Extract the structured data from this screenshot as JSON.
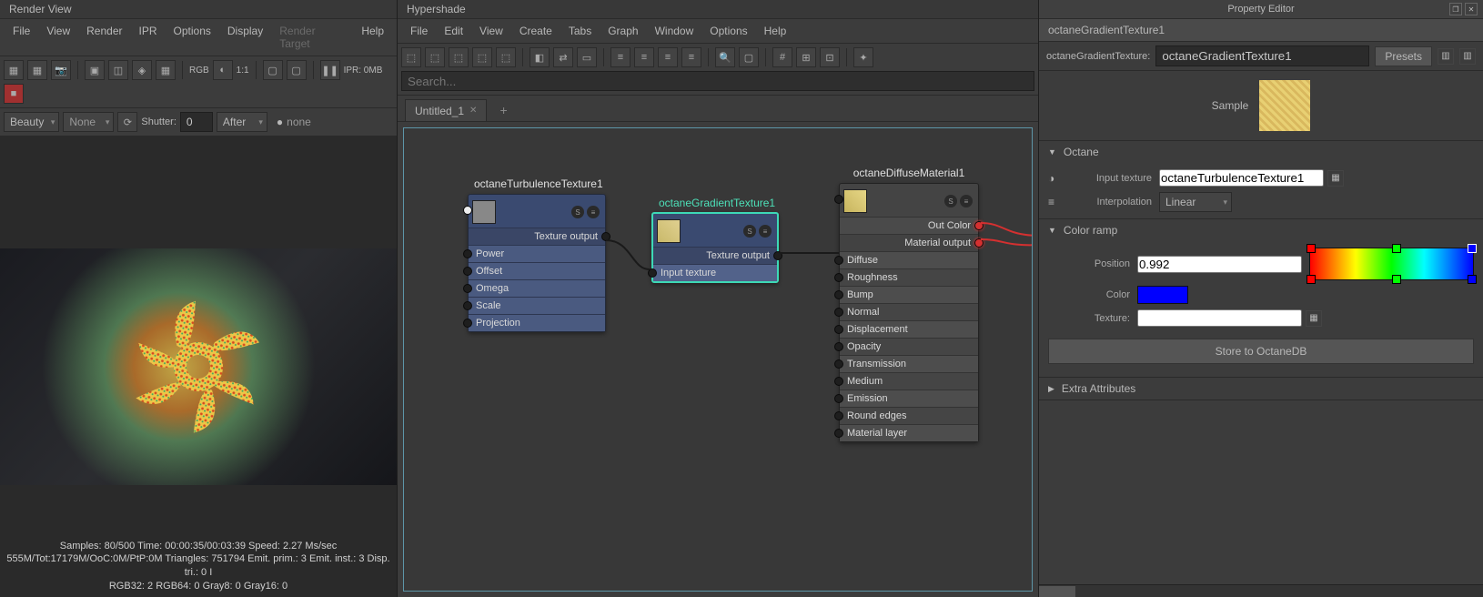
{
  "renderview": {
    "title": "Render View",
    "menus": [
      "File",
      "View",
      "Render",
      "IPR",
      "Options",
      "Display",
      "Render Target",
      "Help"
    ],
    "rgb_label": "RGB",
    "ratio": "1:1",
    "ipr_label": "IPR: 0MB",
    "beauty": "Beauty",
    "none": "None",
    "shutter_label": "Shutter:",
    "shutter_value": "0",
    "after": "After",
    "status_none": "none",
    "stats_line1": "Samples: 80/500 Time: 00:00:35/00:03:39 Speed: 2.27 Ms/sec",
    "stats_line2": "555M/Tot:17179M/OoC:0M/PtP:0M Triangles: 751794 Emit. prim.: 3 Emit. inst.: 3 Disp. tri.: 0 I",
    "stats_line3": "RGB32: 2 RGB64: 0 Gray8: 0 Gray16: 0"
  },
  "hypershade": {
    "title": "Hypershade",
    "menus": [
      "File",
      "Edit",
      "View",
      "Create",
      "Tabs",
      "Graph",
      "Window",
      "Options",
      "Help"
    ],
    "search_placeholder": "Search...",
    "tab": "Untitled_1",
    "nodes": {
      "turb": {
        "title": "octaneTurbulenceTexture1",
        "out": "Texture output",
        "rows": [
          "Power",
          "Offset",
          "Omega",
          "Scale",
          "Projection"
        ]
      },
      "grad": {
        "title": "octaneGradientTexture1",
        "out": "Texture output",
        "rows": [
          "Input texture"
        ]
      },
      "diff": {
        "title": "octaneDiffuseMaterial1",
        "out1": "Out Color",
        "out2": "Material output",
        "rows": [
          "Diffuse",
          "Roughness",
          "Bump",
          "Normal",
          "Displacement",
          "Opacity",
          "Transmission",
          "Medium",
          "Emission",
          "Round edges",
          "Material layer"
        ]
      }
    }
  },
  "pe": {
    "title": "Property Editor",
    "node_name": "octaneGradientTexture1",
    "type_label": "octaneGradientTexture:",
    "type_value": "octaneGradientTexture1",
    "presets": "Presets",
    "sample_label": "Sample",
    "sections": {
      "octane": "Octane",
      "ramp": "Color ramp",
      "extra": "Extra Attributes"
    },
    "input_texture_label": "Input texture",
    "input_texture_value": "octaneTurbulenceTexture1",
    "interpolation_label": "Interpolation",
    "interpolation_value": "Linear",
    "position_label": "Position",
    "position_value": "0.992",
    "color_label": "Color",
    "texture_label": "Texture:",
    "store_button": "Store to OctaneDB"
  }
}
